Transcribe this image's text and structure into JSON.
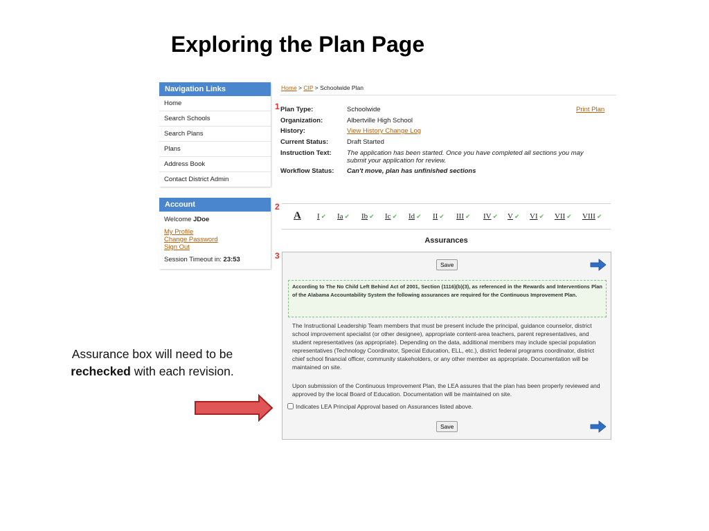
{
  "slide": {
    "title": "Exploring the Plan Page"
  },
  "markers": {
    "m1": "1",
    "m2": "2",
    "m3": "3"
  },
  "nav": {
    "header": "Navigation Links",
    "items": [
      "Home",
      "Search Schools",
      "Search Plans",
      "Plans",
      "Address Book",
      "Contact District Admin"
    ]
  },
  "account": {
    "header": "Account",
    "welcome_prefix": "Welcome",
    "username": "JDoe",
    "links": [
      "My Profile",
      "Change Password",
      "Sign Out"
    ],
    "timeout_label": "Session Timeout in:",
    "timeout_value": "23:53"
  },
  "breadcrumb": {
    "home": "Home",
    "sep1": " > ",
    "cip": "CIP",
    "sep2": " > ",
    "current": "Schoolwide Plan"
  },
  "plan": {
    "type_label": "Plan Type:",
    "type_value": "Schoolwide",
    "org_label": "Organization:",
    "org_value": "Albertville High School",
    "history_label": "History:",
    "history_value": "View History Change Log",
    "status_label": "Current Status:",
    "status_value": "Draft Started",
    "instr_label": "Instruction Text:",
    "instr_value": "The application has been started. Once you have completed all sections you may submit your application for review.",
    "workflow_label": "Workflow Status:",
    "workflow_value": "Can't move, plan has unfinished sections",
    "print_link": "Print Plan"
  },
  "tabs": {
    "first": "A",
    "items": [
      "I",
      "Ia",
      "Ib",
      "Ic",
      "Id",
      "II",
      "III",
      "IV",
      "V",
      "VI",
      "VII",
      "VIII"
    ],
    "check": "✔"
  },
  "assurances": {
    "title": "Assurances",
    "save_label": "Save",
    "notice": "According to The No Child Left Behind Act of 2001, Section (1116)(b)(3), as referenced in the Rewards and Interventions Plan of the Alabama Accountability System the following assurances are required for the Continuous Improvement Plan.",
    "para1": "The Instructional Leadership Team members that must be present include the principal, guidance counselor, district school improvement specialist (or other designee), appropriate content-area teachers, parent representatives, and student representatives (as appropriate). Depending on the data, additional members may include special population representatives (Technology Coordinator, Special Education, ELL, etc.), district federal programs coordinator, district chief school financial officer, community stakeholders, or any other member as appropriate. Documentation will be maintained on site.",
    "para2": "Upon submission of the Continuous Improvement Plan, the LEA assures that the plan has been properly reviewed and approved by the local Board of Education. Documentation will be maintained on site.",
    "checkbox_label": "Indicates LEA Principal Approval based on Assurances listed above.",
    "checkbox_checked": false
  },
  "callout": {
    "line1": "Assurance box will need to be",
    "bold": "rechecked",
    "rest": " with each revision."
  },
  "colors": {
    "nav_header": "#4a86cd",
    "link": "#b45f06",
    "alert": "#e0322a",
    "check": "#5cb85c",
    "arrow_red": "#e05555"
  }
}
